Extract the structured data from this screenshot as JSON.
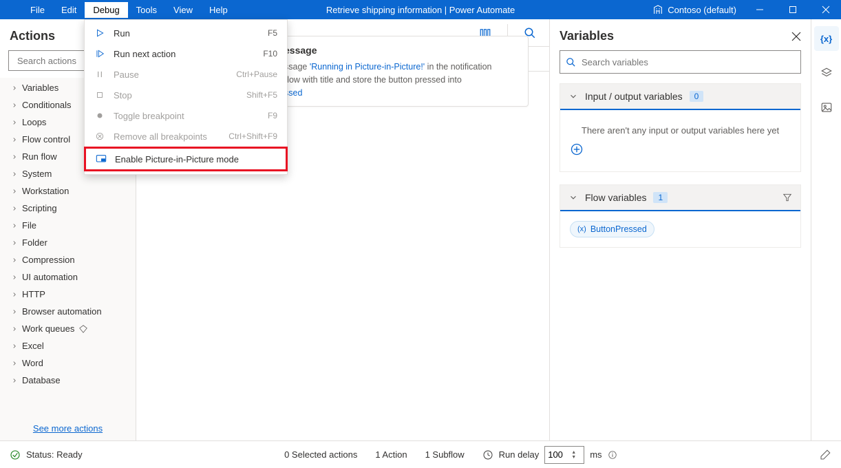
{
  "titlebar": {
    "menus": [
      "File",
      "Edit",
      "Debug",
      "Tools",
      "View",
      "Help"
    ],
    "active_menu": "Debug",
    "title": "Retrieve shipping information | Power Automate",
    "org": "Contoso (default)"
  },
  "debug_menu": [
    {
      "icon": "play",
      "label": "Run",
      "shortcut": "F5",
      "disabled": false
    },
    {
      "icon": "step",
      "label": "Run next action",
      "shortcut": "F10",
      "disabled": false
    },
    {
      "icon": "pause",
      "label": "Pause",
      "shortcut": "Ctrl+Pause",
      "disabled": true
    },
    {
      "icon": "stop",
      "label": "Stop",
      "shortcut": "Shift+F5",
      "disabled": true
    },
    {
      "icon": "circle",
      "label": "Toggle breakpoint",
      "shortcut": "F9",
      "disabled": true
    },
    {
      "icon": "clear",
      "label": "Remove all breakpoints",
      "shortcut": "Ctrl+Shift+F9",
      "disabled": true
    },
    {
      "icon": "pip",
      "label": "Enable Picture-in-Picture mode",
      "shortcut": "",
      "disabled": false,
      "highlight": true
    }
  ],
  "actions": {
    "title": "Actions",
    "search_placeholder": "Search actions",
    "tree": [
      "Variables",
      "Conditionals",
      "Loops",
      "Flow control",
      "Run flow",
      "System",
      "Workstation",
      "Scripting",
      "File",
      "Folder",
      "Compression",
      "UI automation",
      "HTTP",
      "Browser automation",
      "Work queues",
      "Excel",
      "Word",
      "Database"
    ],
    "premium_index": 14,
    "see_more": "See more actions"
  },
  "canvas": {
    "step_title": "essage",
    "line1_a": "ssage ",
    "line1_link": "'Running in Picture-in-Picture!'",
    "line1_b": " in the notification",
    "line2": "dow with title  and store the button pressed into",
    "line3_var": "ssed"
  },
  "variables": {
    "title": "Variables",
    "search_placeholder": "Search variables",
    "io_section": {
      "title": "Input / output variables",
      "count": "0",
      "empty": "There aren't any input or output variables here yet"
    },
    "flow_section": {
      "title": "Flow variables",
      "count": "1",
      "chips": [
        "ButtonPressed"
      ]
    }
  },
  "status": {
    "text": "Status: Ready",
    "selected": "0 Selected actions",
    "actions": "1 Action",
    "subflows": "1 Subflow",
    "run_delay_label": "Run delay",
    "run_delay_value": "100",
    "ms": "ms"
  }
}
